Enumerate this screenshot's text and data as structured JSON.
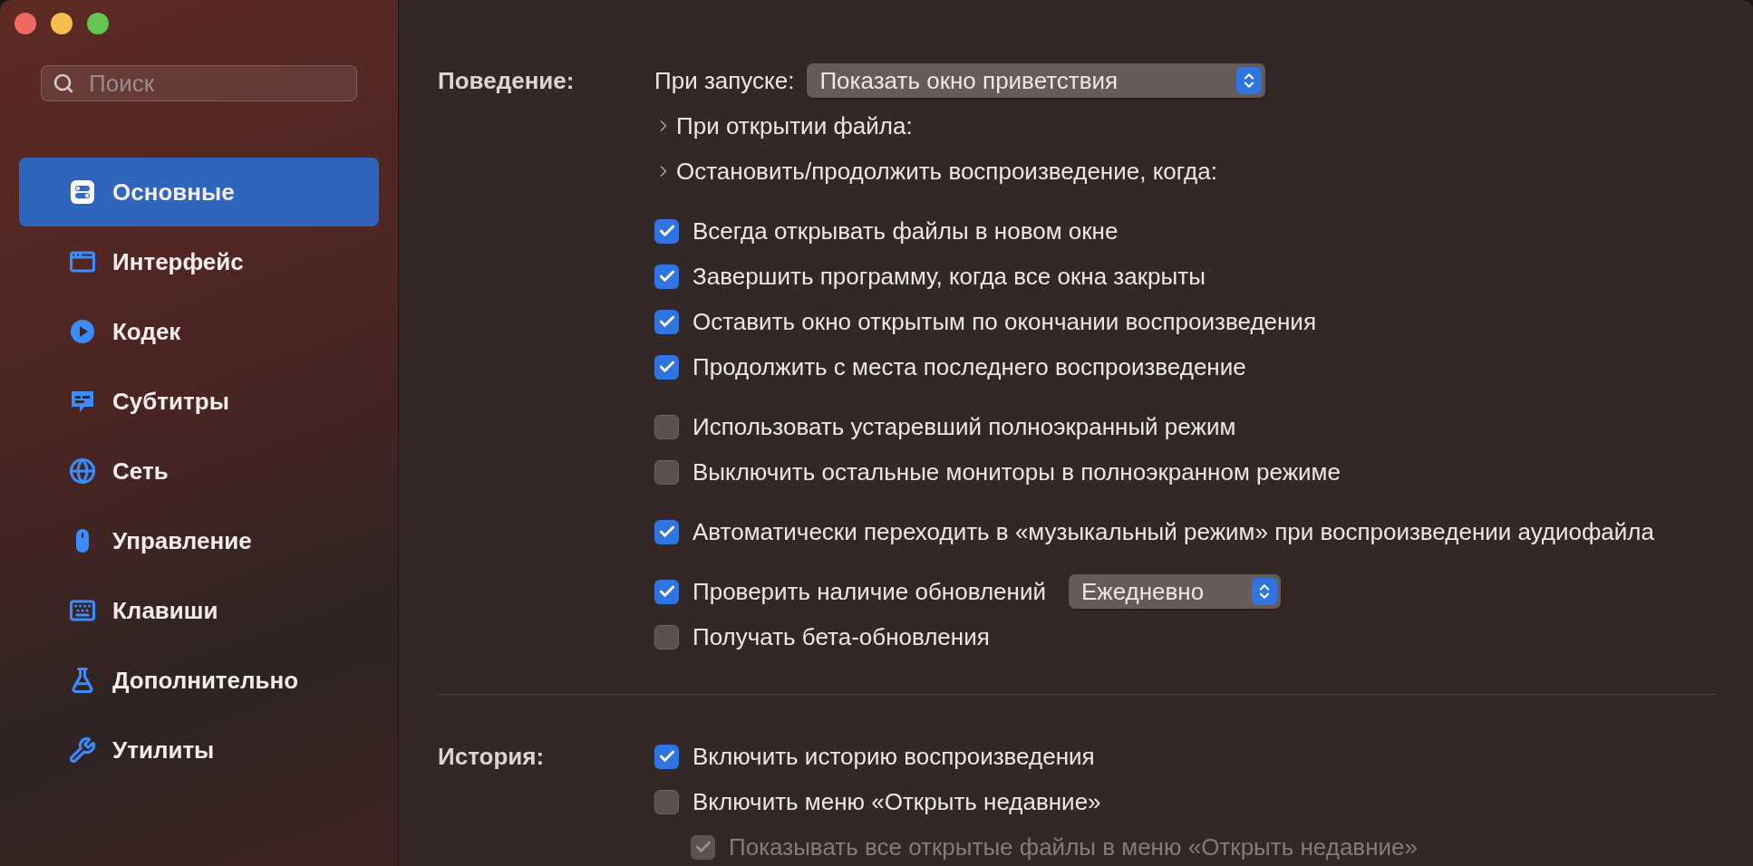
{
  "search": {
    "placeholder": "Поиск"
  },
  "sidebar": {
    "items": [
      {
        "label": "Основные",
        "selected": true,
        "kind": "general"
      },
      {
        "label": "Интерфейс",
        "selected": false,
        "kind": "window"
      },
      {
        "label": "Кодек",
        "selected": false,
        "kind": "play"
      },
      {
        "label": "Субтитры",
        "selected": false,
        "kind": "subtitles"
      },
      {
        "label": "Сеть",
        "selected": false,
        "kind": "globe"
      },
      {
        "label": "Управление",
        "selected": false,
        "kind": "mouse"
      },
      {
        "label": "Клавиши",
        "selected": false,
        "kind": "keyboard"
      },
      {
        "label": "Дополнительно",
        "selected": false,
        "kind": "flask"
      },
      {
        "label": "Утилиты",
        "selected": false,
        "kind": "wrench"
      }
    ]
  },
  "sections": [
    {
      "label": "Поведение:",
      "groups": [
        {
          "rows": [
            {
              "kind": "popup",
              "label": "При запуске:",
              "value": "Показать окно приветствия"
            },
            {
              "kind": "disclosure",
              "label": "При открытии файла:",
              "expanded": false
            },
            {
              "kind": "disclosure",
              "label": "Остановить/продолжить воспроизведение, когда:",
              "expanded": false
            }
          ]
        },
        {
          "rows": [
            {
              "kind": "checkbox",
              "label": "Всегда открывать файлы в новом окне",
              "checked": true
            },
            {
              "kind": "checkbox",
              "label": "Завершить программу, когда все окна закрыты",
              "checked": true
            },
            {
              "kind": "checkbox",
              "label": "Оставить окно открытым по окончании воспроизведения",
              "checked": true
            },
            {
              "kind": "checkbox",
              "label": "Продолжить с места последнего воспроизведение",
              "checked": true
            }
          ]
        },
        {
          "rows": [
            {
              "kind": "checkbox",
              "label": "Использовать устаревший полноэкранный режим",
              "checked": false
            },
            {
              "kind": "checkbox",
              "label": "Выключить остальные мониторы в полноэкранном режиме",
              "checked": false
            }
          ]
        },
        {
          "rows": [
            {
              "kind": "checkbox",
              "label": "Автоматически переходить в «музыкальный режим» при воспроизведении аудиофайла",
              "checked": true
            }
          ]
        },
        {
          "rows": [
            {
              "kind": "checkbox_popup",
              "label": "Проверить наличие обновлений",
              "checked": true,
              "value": "Ежедневно"
            },
            {
              "kind": "checkbox",
              "label": "Получать бета-обновления",
              "checked": false
            }
          ]
        }
      ]
    },
    {
      "label": "История:",
      "groups": [
        {
          "rows": [
            {
              "kind": "checkbox",
              "label": "Включить историю воспроизведения",
              "checked": true
            },
            {
              "kind": "checkbox",
              "label": "Включить меню «Открыть недавние»",
              "checked": false,
              "children": [
                {
                  "kind": "checkbox",
                  "label": "Показывать все открытые файлы в меню «Открыть недавние»",
                  "checked": true,
                  "disabled": true
                }
              ]
            }
          ]
        }
      ]
    }
  ]
}
